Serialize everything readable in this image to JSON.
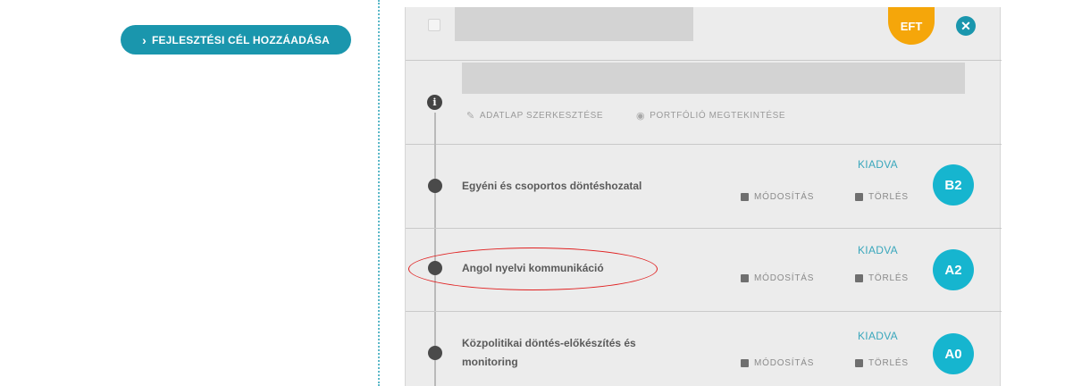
{
  "left": {
    "add_goal_button": {
      "label": "FEJLESZTÉSI CÉL HOZZÁADÁSA",
      "icon": "chevron-right-icon"
    }
  },
  "header": {
    "badge": "EFT",
    "close_icon": "close-circle-icon"
  },
  "info": {
    "edit_sheet_label": "ADATLAP SZERKESZTÉSE",
    "view_portfolio_label": "PORTFÓLIÓ MEGTEKINTÉSE"
  },
  "goals": [
    {
      "title": "Egyéni és csoportos döntéshozatal",
      "status": "KIADVA",
      "modify_label": "MÓDOSÍTÁS",
      "delete_label": "TÖRLÉS",
      "level": "B2"
    },
    {
      "title": "Angol nyelvi kommunikáció",
      "status": "KIADVA",
      "modify_label": "MÓDOSÍTÁS",
      "delete_label": "TÖRLÉS",
      "level": "A2"
    },
    {
      "title": "Közpolitikai döntés-előkészítés és monitoring",
      "status": "KIADVA",
      "modify_label": "MÓDOSÍTÁS",
      "delete_label": "TÖRLÉS",
      "level": "A0"
    }
  ],
  "colors": {
    "accent": "#1a96ad",
    "level_badge": "#16b5cf",
    "eft_badge": "#f5a60a",
    "highlight": "#e02020"
  }
}
